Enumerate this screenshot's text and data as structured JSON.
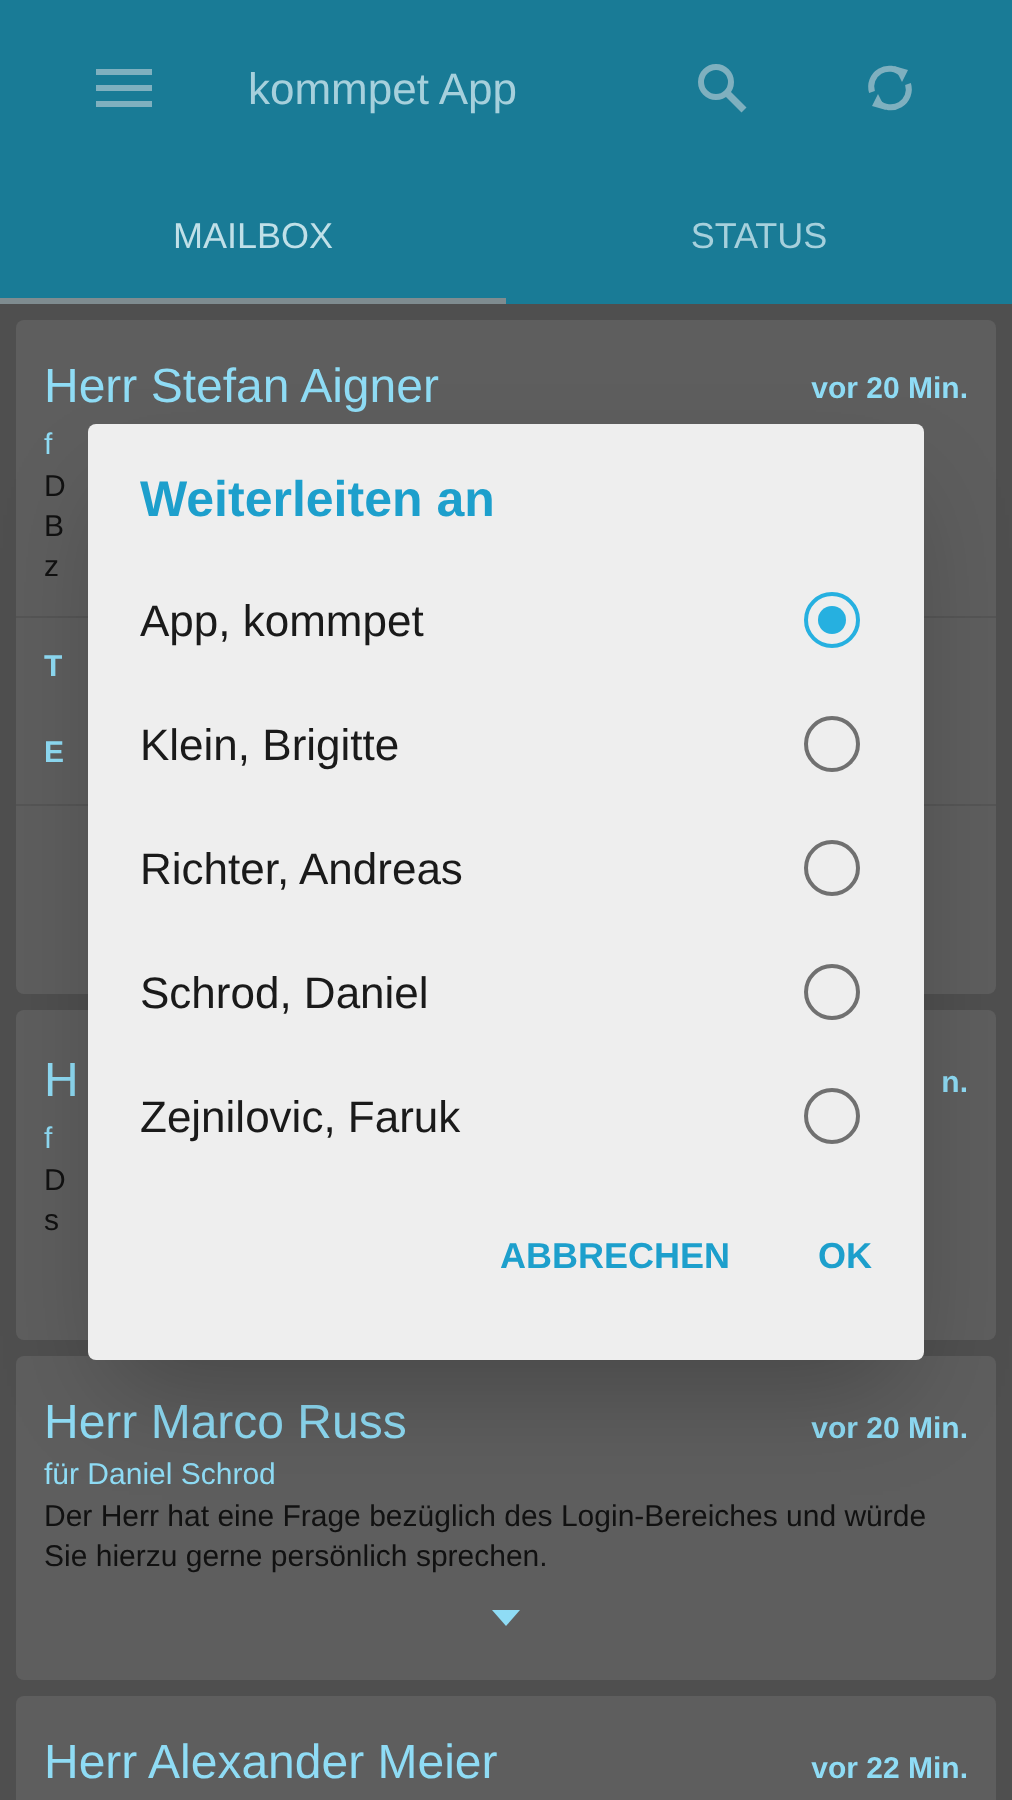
{
  "app_bar": {
    "title": "kommpet App"
  },
  "tabs": [
    {
      "label": "MAILBOX",
      "selected": true
    },
    {
      "label": "STATUS",
      "selected": false
    }
  ],
  "cards": [
    {
      "title": "Herr Stefan Aigner",
      "time": "vor 20 Min.",
      "fragments": [
        "f",
        "D",
        "B",
        "z"
      ],
      "extra": [
        "T",
        "E"
      ]
    },
    {
      "title": "H",
      "time": "n.",
      "fragments": [
        "f",
        "D",
        "s"
      ]
    },
    {
      "title": "Herr Marco Russ",
      "time": "vor 20 Min.",
      "recipient": "für Daniel Schrod",
      "body": "Der Herr hat eine Frage bezüglich des Login-Bereiches und würde Sie hierzu gerne persönlich sprechen.",
      "expandable": true
    },
    {
      "title": "Herr Alexander Meier",
      "time": "vor 22 Min."
    }
  ],
  "dialog": {
    "title": "Weiterleiten an",
    "options": [
      {
        "label": "App, kommpet",
        "selected": true
      },
      {
        "label": "Klein, Brigitte",
        "selected": false
      },
      {
        "label": "Richter, Andreas",
        "selected": false
      },
      {
        "label": "Schrod, Daniel",
        "selected": false
      },
      {
        "label": "Zejnilovic, Faruk",
        "selected": false
      }
    ],
    "buttons": [
      "ABBRECHEN",
      "OK"
    ]
  }
}
